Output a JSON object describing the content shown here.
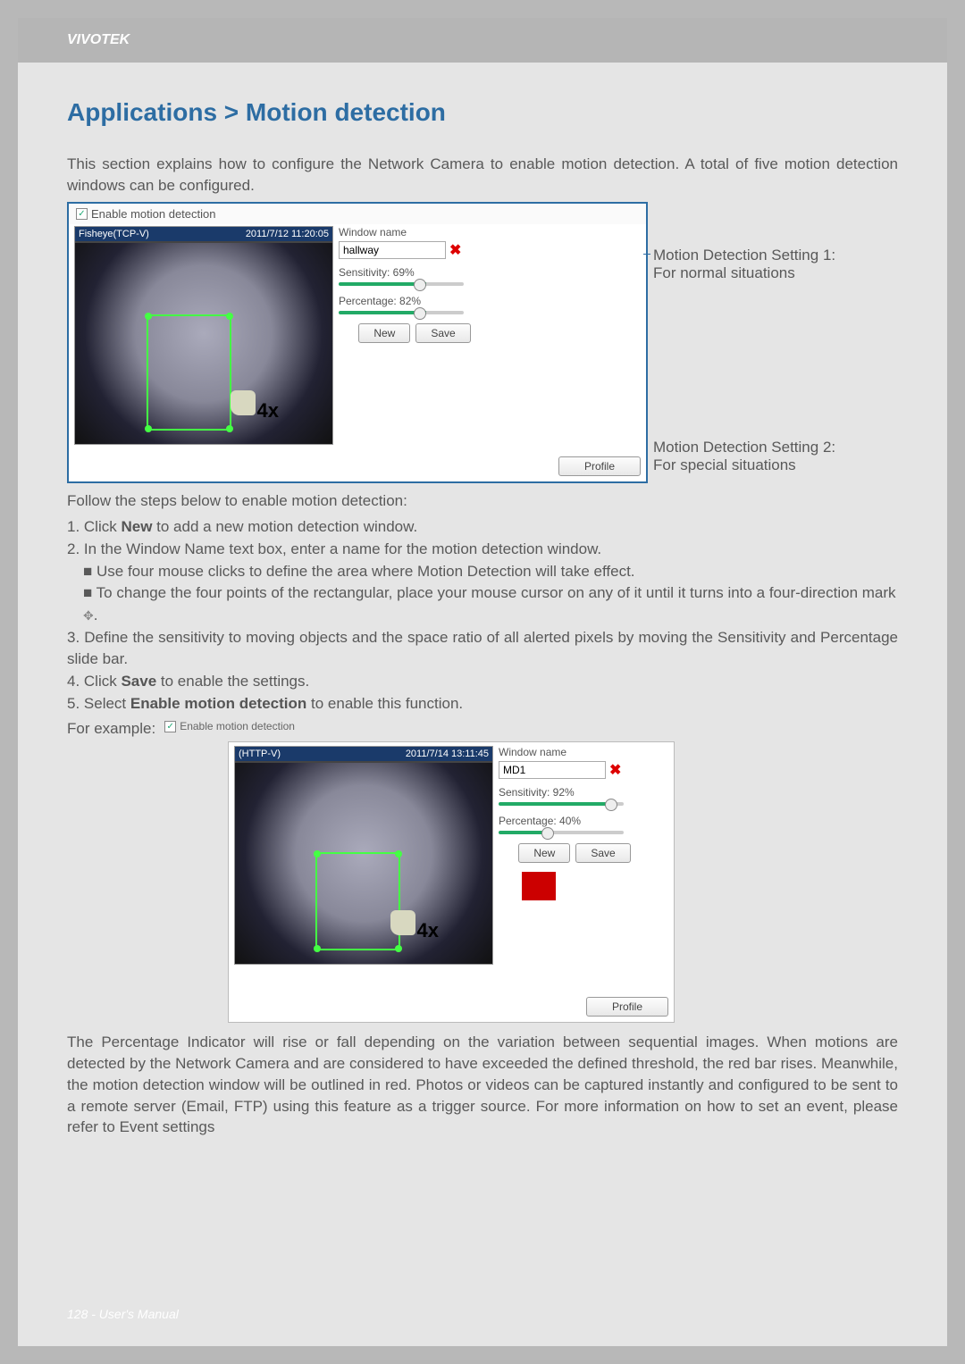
{
  "header": {
    "brand": "VIVOTEK"
  },
  "title": "Applications > Motion detection",
  "intro": "This section explains how to configure the Network Camera to enable motion detection. A total of five motion detection windows can be configured.",
  "shot1": {
    "enable_label": "Enable motion detection",
    "cam_name": "Fisheye(TCP-V)",
    "timestamp": "2011/7/12 11:20:05",
    "overlay_4x": "4x",
    "panel": {
      "winlabel": "Window name",
      "winvalue": "hallway",
      "sens_label": "Sensitivity: 69%",
      "perc_label": "Percentage: 82%",
      "new_btn": "New",
      "save_btn": "Save",
      "profile_btn": "Profile"
    }
  },
  "annotations": {
    "a1_title": "Motion Detection Setting 1:",
    "a1_sub": "For normal situations",
    "a2_title": "Motion Detection Setting 2:",
    "a2_sub": "For special situations"
  },
  "steps_lead": "Follow the steps below to enable motion detection:",
  "steps": {
    "s1a": "1. Click ",
    "s1b": "New",
    "s1c": " to add a new motion detection window.",
    "s2": "2. In the Window Name text box, enter a name for the motion detection window.",
    "s2b1": "■ Use four mouse clicks to define the area where Motion Detection will take effect.",
    "s2b2a": "■ To change the four points of the rectangular, place your mouse cursor on any of it until it turns into a four-direction mark ",
    "s2b2b": ".",
    "s3": "3. Define the sensitivity to moving objects and the space ratio of all alerted pixels by moving the Sensitivity and Percentage slide bar.",
    "s4a": "4. Click ",
    "s4b": "Save",
    "s4c": " to enable the settings.",
    "s5a": "5. Select ",
    "s5b": "Enable motion detection",
    "s5c": " to enable this function."
  },
  "example_label": "For example:",
  "example_enable": "Enable motion detection",
  "shot2": {
    "cam_name": "(HTTP-V)",
    "timestamp": "2011/7/14 13:11:45",
    "overlay_4x": "4x",
    "panel": {
      "winlabel": "Window name",
      "winvalue": "MD1",
      "sens_label": "Sensitivity: 92%",
      "perc_label": "Percentage: 40%",
      "new_btn": "New",
      "save_btn": "Save",
      "profile_btn": "Profile"
    }
  },
  "bottom_para": "The Percentage Indicator will rise or fall depending on the variation between sequential images. When motions are detected by the Network Camera and are considered to have exceeded the defined threshold, the red bar rises. Meanwhile, the motion detection window will be outlined in red. Photos or videos can be captured instantly and configured to be sent to a remote server (Email, FTP) using this feature as a trigger source. For more information on how to set an event, please refer to Event settings",
  "footer": "128 - User's Manual"
}
